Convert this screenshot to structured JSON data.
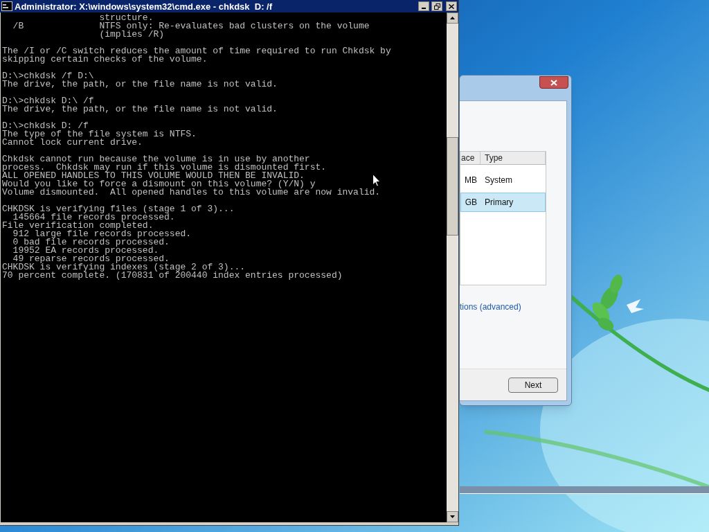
{
  "cmd_window": {
    "title": "Administrator: X:\\windows\\system32\\cmd.exe - chkdsk  D: /f",
    "console_blocks": [
      [
        "                  structure.",
        "  /B              NTFS only: Re-evaluates bad clusters on the volume",
        "                  (implies /R)"
      ],
      [
        "The /I or /C switch reduces the amount of time required to run Chkdsk by",
        "skipping certain checks of the volume."
      ],
      [
        "D:\\>chkdsk /f D:\\",
        "The drive, the path, or the file name is not valid."
      ],
      [
        "D:\\>chkdsk D:\\ /f",
        "The drive, the path, or the file name is not valid."
      ],
      [
        "D:\\>chkdsk D: /f",
        "The type of the file system is NTFS.",
        "Cannot lock current drive."
      ],
      [
        "Chkdsk cannot run because the volume is in use by another",
        "process.  Chkdsk may run if this volume is dismounted first.",
        "ALL OPENED HANDLES TO THIS VOLUME WOULD THEN BE INVALID.",
        "Would you like to force a dismount on this volume? (Y/N) y",
        "Volume dismounted.  All opened handles to this volume are now invalid."
      ],
      [
        "CHKDSK is verifying files (stage 1 of 3)...",
        "  145664 file records processed.",
        "File verification completed.",
        "  912 large file records processed.",
        "  0 bad file records processed.",
        "  19952 EA records processed.",
        "  49 reparse records processed.",
        "CHKDSK is verifying indexes (stage 2 of 3)...",
        "70 percent complete. (170831 of 200440 index entries processed)"
      ]
    ]
  },
  "setup_dialog": {
    "columns": [
      "ace",
      "Type"
    ],
    "rows": [
      {
        "cells": [
          "MB",
          "System"
        ],
        "selected": false
      },
      {
        "cells": [
          "GB",
          "Primary"
        ],
        "selected": true
      }
    ],
    "link": "tions (advanced)",
    "next_button": "Next"
  }
}
